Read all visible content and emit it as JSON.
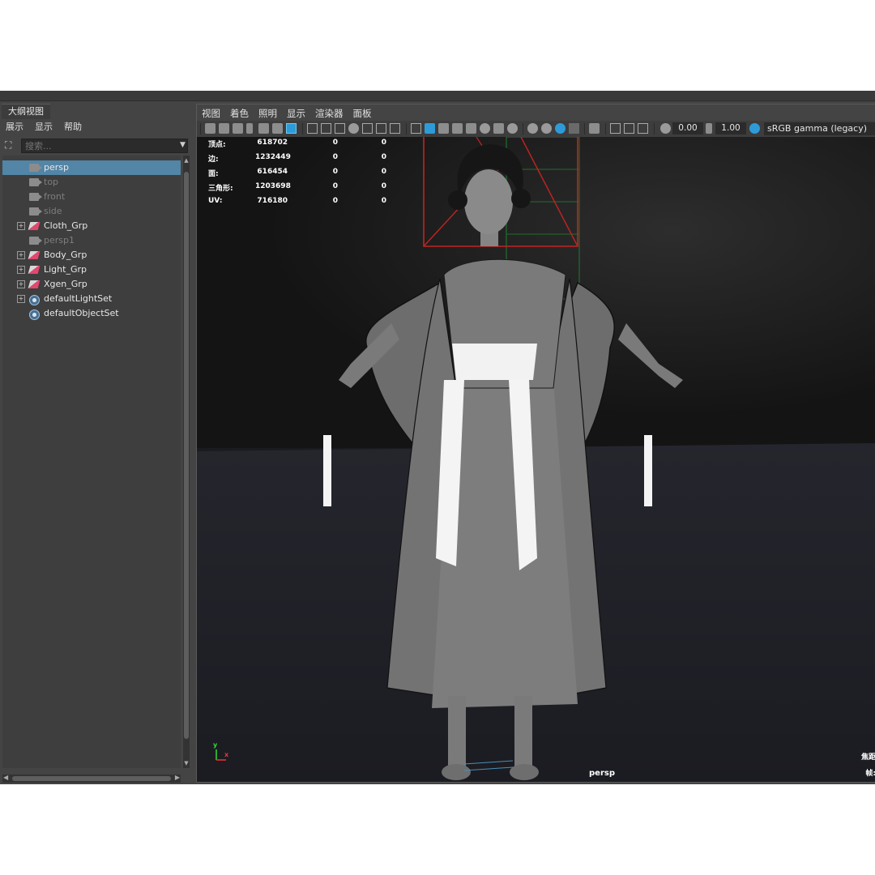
{
  "outliner": {
    "tab": "大纲视图",
    "menu": [
      "展示",
      "显示",
      "帮助"
    ],
    "search_placeholder": "搜索...",
    "items": [
      {
        "label": "persp",
        "icon": "camera-icon",
        "selected": true,
        "dim": false,
        "expandable": false
      },
      {
        "label": "top",
        "icon": "camera-icon",
        "selected": false,
        "dim": true,
        "expandable": false
      },
      {
        "label": "front",
        "icon": "camera-icon",
        "selected": false,
        "dim": true,
        "expandable": false
      },
      {
        "label": "side",
        "icon": "camera-icon",
        "selected": false,
        "dim": true,
        "expandable": false
      },
      {
        "label": "Cloth_Grp",
        "icon": "group-icon",
        "selected": false,
        "dim": false,
        "expandable": true
      },
      {
        "label": "persp1",
        "icon": "camera-icon",
        "selected": false,
        "dim": true,
        "expandable": false
      },
      {
        "label": "Body_Grp",
        "icon": "group-icon",
        "selected": false,
        "dim": false,
        "expandable": true
      },
      {
        "label": "Light_Grp",
        "icon": "group-icon",
        "selected": false,
        "dim": false,
        "expandable": true
      },
      {
        "label": "Xgen_Grp",
        "icon": "group-icon",
        "selected": false,
        "dim": false,
        "expandable": true
      },
      {
        "label": "defaultLightSet",
        "icon": "set-icon",
        "selected": false,
        "dim": false,
        "expandable": true
      },
      {
        "label": "defaultObjectSet",
        "icon": "set-icon",
        "selected": false,
        "dim": false,
        "expandable": false
      }
    ]
  },
  "viewport": {
    "menu": [
      "视图",
      "着色",
      "照明",
      "显示",
      "渲染器",
      "面板"
    ],
    "toolbar": {
      "exposure": "0.00",
      "gamma": "1.00",
      "color_space": "sRGB gamma (legacy)"
    },
    "hud": [
      {
        "label": "顶点:",
        "v1": "618702",
        "v2": "0",
        "v3": "0"
      },
      {
        "label": "边:",
        "v1": "1232449",
        "v2": "0",
        "v3": "0"
      },
      {
        "label": "面:",
        "v1": "616454",
        "v2": "0",
        "v3": "0"
      },
      {
        "label": "三角形:",
        "v1": "1203698",
        "v2": "0",
        "v3": "0"
      },
      {
        "label": "UV:",
        "v1": "716180",
        "v2": "0",
        "v3": "0"
      }
    ],
    "camera_label": "persp",
    "axis": {
      "y": "y",
      "x": "x"
    },
    "right_labels": [
      "焦距",
      "帧:"
    ]
  },
  "colors": {
    "selection": "#5285a6",
    "accent": "#2e9bd8",
    "panel": "#444444",
    "viewport_bg": "#1a1b1f"
  }
}
